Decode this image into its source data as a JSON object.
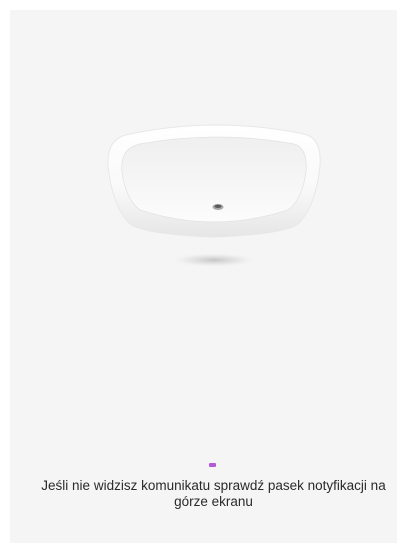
{
  "status": {
    "message": "Jeśli nie widzisz komunikatu sprawdź pasek notyfikacji na górze ekranu"
  },
  "illustration": {
    "icon": "basin-device-icon"
  },
  "colors": {
    "background": "#f5f5f5",
    "accent": "#b25ad8",
    "text": "#2a2a2a"
  }
}
